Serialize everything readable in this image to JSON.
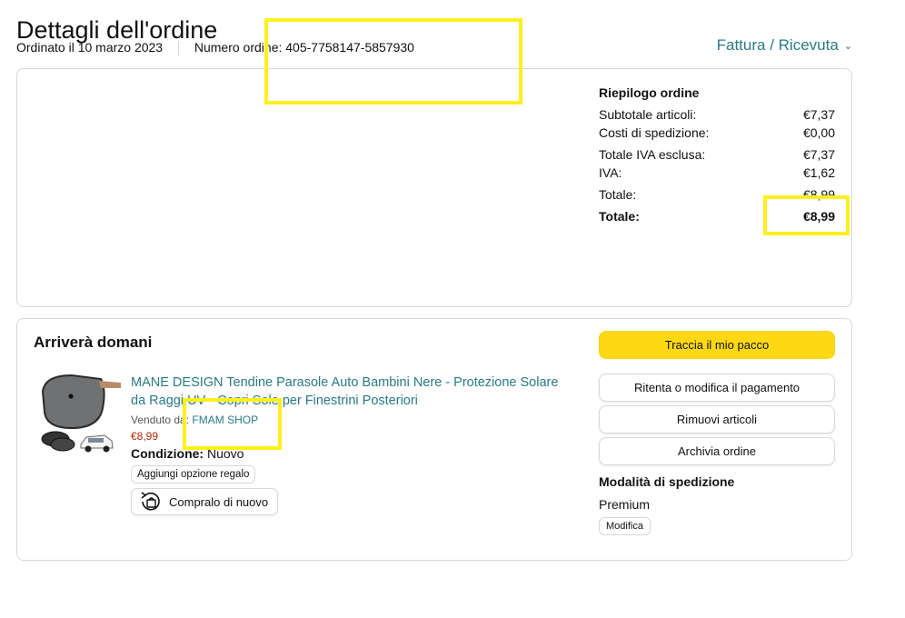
{
  "header": {
    "title": "Dettagli dell'ordine",
    "ordered_on": "Ordinato il 10 marzo 2023",
    "order_number_label": "Numero ordine:",
    "order_number": "405-7758147-5857930",
    "invoice_link": "Fattura / Ricevuta"
  },
  "summary": {
    "title": "Riepilogo ordine",
    "rows": [
      {
        "label": "Subtotale articoli:",
        "value": "€7,37"
      },
      {
        "label": "Costi di spedizione:",
        "value": "€0,00"
      },
      {
        "label": "Totale IVA esclusa:",
        "value": "€7,37"
      },
      {
        "label": "IVA:",
        "value": "€1,62"
      },
      {
        "label": "Totale:",
        "value": "€8,99"
      }
    ],
    "grand_total_label": "Totale:",
    "grand_total_value": "€8,99"
  },
  "shipment": {
    "title": "Arriverà domani",
    "item": {
      "title": "MANE DESIGN Tendine Parasole Auto Bambini Nere - Protezione Solare da Raggi UV - Copri Sole per Finestrini Posteriori",
      "sold_by_label": "Venduto da:",
      "seller": "FMAM SHOP",
      "price": "€8,99",
      "condition_label": "Condizione:",
      "condition": "Nuovo",
      "gift_button": "Aggiungi opzione regalo",
      "rebuy_button": "Compralo di nuovo"
    },
    "actions": {
      "track": "Traccia il mio pacco",
      "retry_payment": "Ritenta o modifica il pagamento",
      "remove_items": "Rimuovi articoli",
      "archive": "Archivia ordine"
    },
    "shipping_mode_title": "Modalità di spedizione",
    "shipping_mode": "Premium",
    "modify_button": "Modifica"
  },
  "colors": {
    "link": "#2a7a85",
    "primary_button": "#ffd814",
    "price": "#b12704",
    "highlight": "#ffef1f"
  }
}
